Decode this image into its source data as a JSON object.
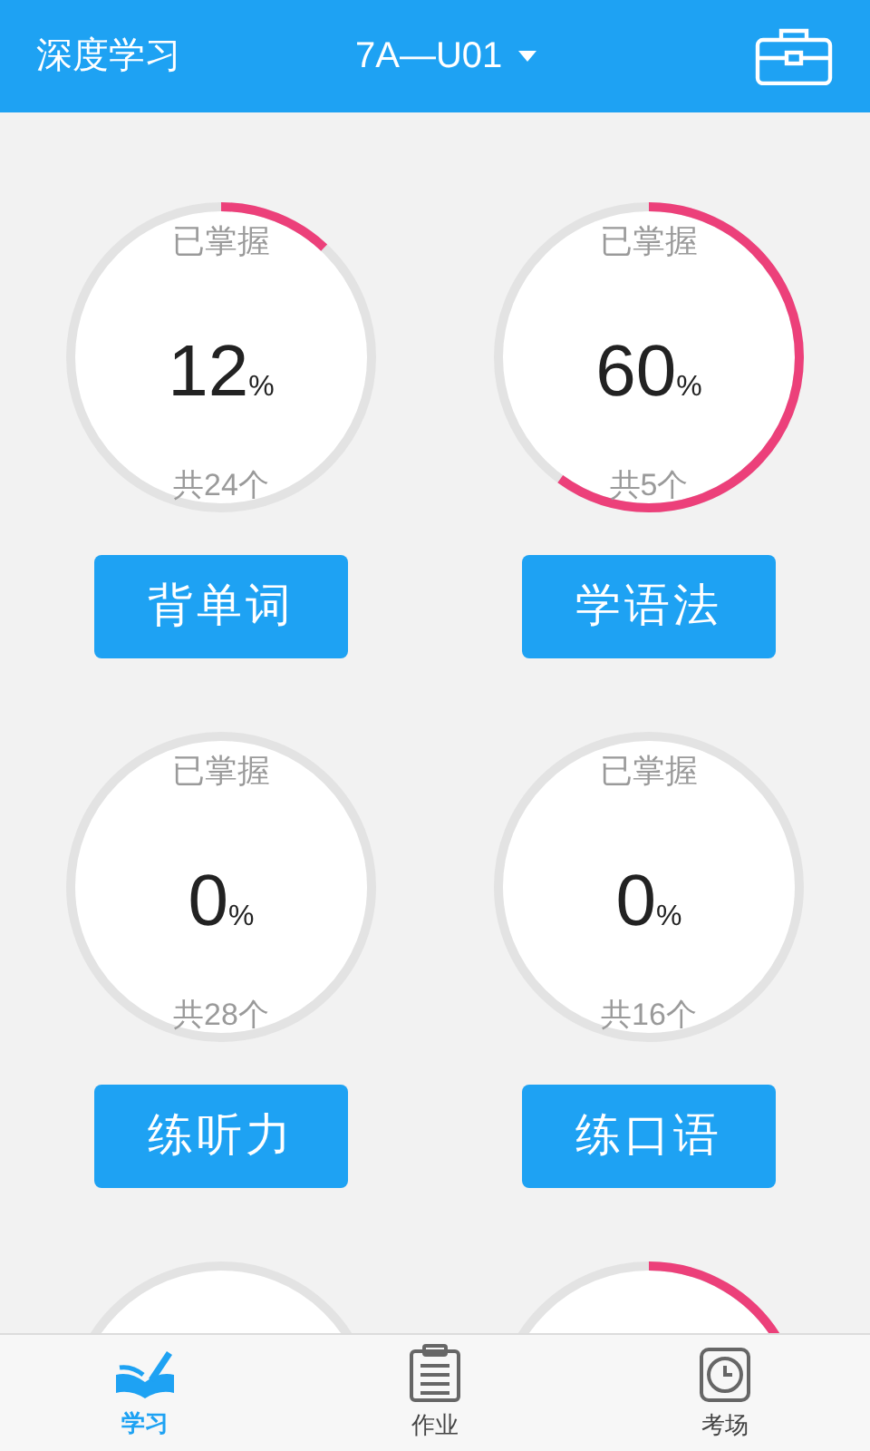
{
  "header": {
    "title": "深度学习",
    "unit": "7A—U01"
  },
  "skills": [
    {
      "caption": "已掌握",
      "value": "12",
      "unit": "%",
      "total": "共24个",
      "button": "背单词"
    },
    {
      "caption": "已掌握",
      "value": "60",
      "unit": "%",
      "total": "共5个",
      "button": "学语法"
    },
    {
      "caption": "已掌握",
      "value": "0",
      "unit": "%",
      "total": "共28个",
      "button": "练听力"
    },
    {
      "caption": "已掌握",
      "value": "0",
      "unit": "%",
      "total": "共16个",
      "button": "练口语"
    }
  ],
  "tabs": [
    {
      "label": "学习",
      "selected": true
    },
    {
      "label": "作业",
      "selected": false
    },
    {
      "label": "考场",
      "selected": false
    }
  ]
}
